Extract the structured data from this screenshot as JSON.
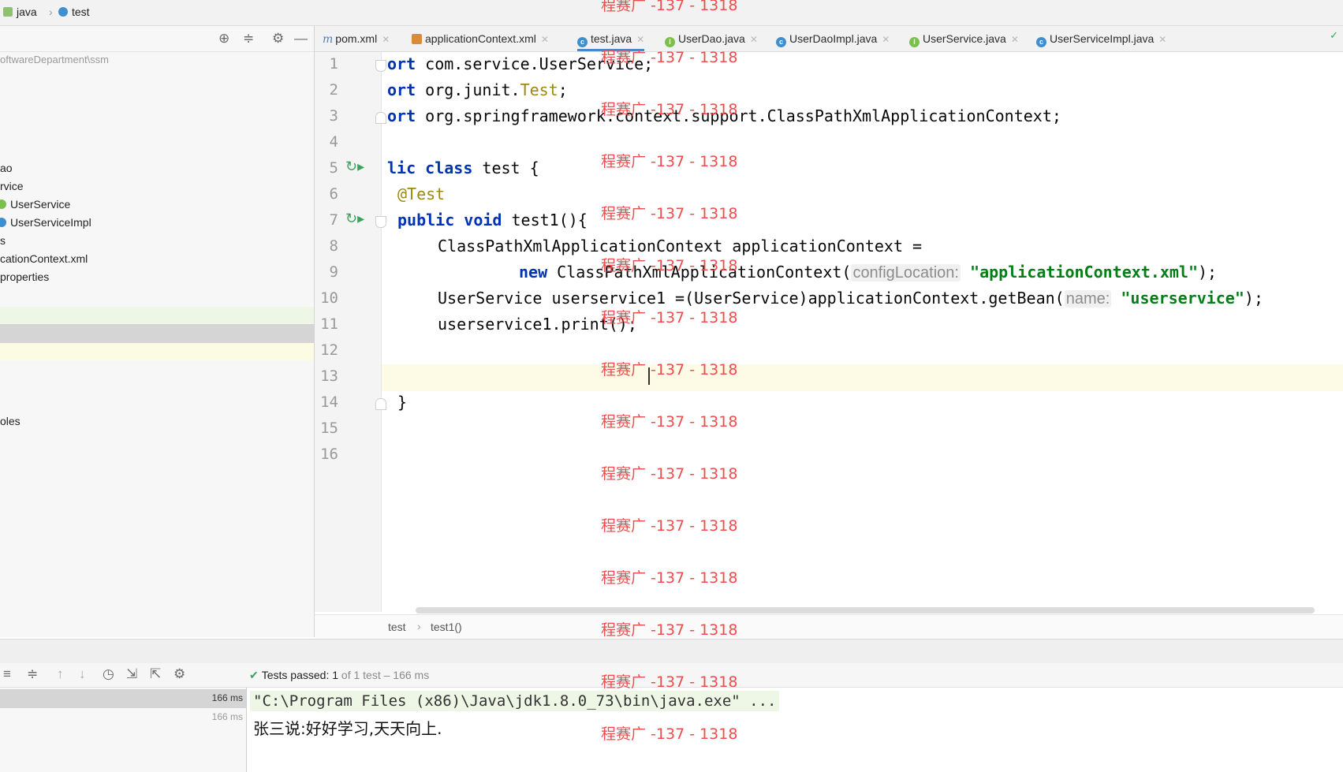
{
  "navbar": {
    "crumb_java": "java",
    "crumb_test": "test"
  },
  "project_panel": {
    "path": "oftwareDepartment\\ssm",
    "rows": [
      "ao",
      "rvice",
      "UserService",
      "UserServiceImpl",
      "s",
      "cationContext.xml",
      "properties",
      "oles"
    ]
  },
  "tabs": [
    {
      "label": "pom.xml",
      "icon": "maven-icon",
      "active": false
    },
    {
      "label": "applicationContext.xml",
      "icon": "xml-file-icon",
      "active": false
    },
    {
      "label": "test.java",
      "icon": "class-file-icon",
      "active": true
    },
    {
      "label": "UserDao.java",
      "icon": "interface-file-icon",
      "active": false
    },
    {
      "label": "UserDaoImpl.java",
      "icon": "class-file-icon",
      "active": false
    },
    {
      "label": "UserService.java",
      "icon": "interface-file-icon",
      "active": false
    },
    {
      "label": "UserServiceImpl.java",
      "icon": "class-file-icon",
      "active": false
    }
  ],
  "editor": {
    "line_numbers": [
      "1",
      "2",
      "3",
      "4",
      "5",
      "6",
      "7",
      "8",
      "9",
      "10",
      "11",
      "12",
      "13",
      "14",
      "15",
      "16"
    ],
    "code": {
      "l1_kw": "ort",
      "l1_rest": " com.service.UserService;",
      "l2_kw": "ort",
      "l2_a": " org.junit.",
      "l2_cls": "Test",
      "l2_b": ";",
      "l3_kw": "ort",
      "l3_rest": " org.springframework.context.support.ClassPathXmlApplicationContext;",
      "l5_kw": "lic class",
      "l5_rest": " test {",
      "l6_ann": "@Test",
      "l7_kw": "public void",
      "l7_rest": " test1(){",
      "l8": "ClassPathXmlApplicationContext applicationContext =",
      "l9_kw": "new",
      "l9_a": " ClassPathXmlApplicationContext(",
      "l9_hint": "configLocation:",
      "l9_str": "\"applicationContext.xml\"",
      "l9_b": ");",
      "l10_a": "UserService userservice1 =(UserService)applicationContext.getBean(",
      "l10_hint": "name:",
      "l10_str": "\"userservice\"",
      "l10_b": ");",
      "l11": "userservice1.print();",
      "l14": "}"
    }
  },
  "breadcrumb": {
    "item1": "test",
    "item2": "test1()"
  },
  "run_panel": {
    "status_strong": "Tests passed: 1",
    "status_rest": "of 1 test – 166 ms",
    "tree_time1": "166 ms",
    "tree_time2": "166 ms",
    "console_line1": "\"C:\\Program Files (x86)\\Java\\jdk1.8.0_73\\bin\\java.exe\" ...",
    "console_line2": "张三说:好好学习,天天向上."
  },
  "watermark": "程赛广 -137 - 1318"
}
